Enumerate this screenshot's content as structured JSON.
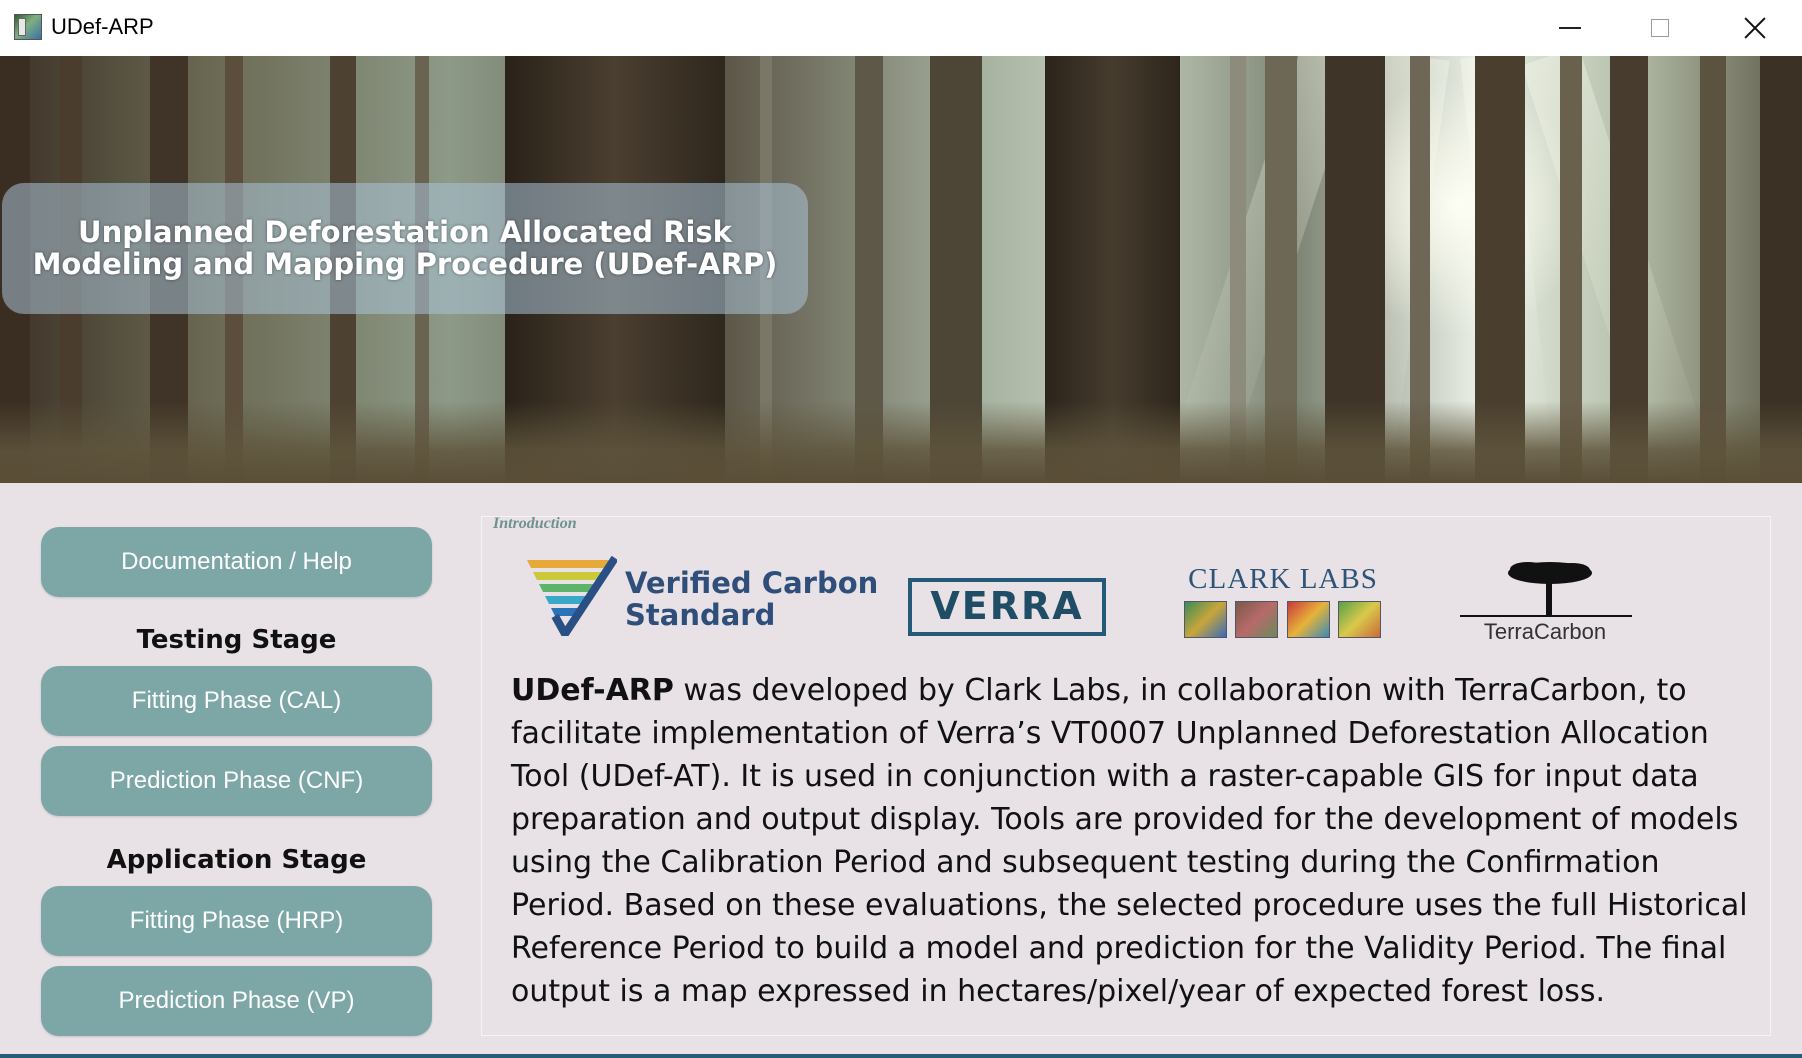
{
  "window": {
    "title": "UDef-ARP",
    "icons": {
      "app": "app-icon",
      "minimize": "minimize-icon",
      "maximize": "maximize-icon",
      "close": "close-icon"
    }
  },
  "banner": {
    "title_line1": "Unplanned Deforestation Allocated Risk",
    "title_line2": "Modeling and Mapping Procedure (UDef-ARP)"
  },
  "sidebar": {
    "documentation_button": "Documentation / Help",
    "testing_stage_label": "Testing Stage",
    "testing_fit_button": "Fitting Phase (CAL)",
    "testing_predict_button": "Prediction Phase (CNF)",
    "application_stage_label": "Application Stage",
    "application_fit_button": "Fitting Phase (HRP)",
    "application_predict_button": "Prediction Phase (VP)"
  },
  "introduction": {
    "label": "Introduction",
    "logos": {
      "vcs_line1": "Verified Carbon",
      "vcs_line2": "Standard",
      "verra": "VERRA",
      "clark_labs": "CLARK LABS",
      "terracarbon": "TerraCarbon"
    },
    "body_bold": "UDef-ARP",
    "body_rest": " was developed by Clark Labs, in collaboration with TerraCarbon, to facilitate implementation of Verra’s VT0007 Unplanned Deforestation Allocation Tool (UDef-AT). It is used in conjunction with a raster-capable GIS for input data preparation and output display. Tools are provided for the development of models using the Calibration Period and subsequent testing during the Confirmation Period. Based on these evaluations, the selected procedure uses the full Historical Reference Period to build a model and prediction for the Validity Period. The final output is a map expressed in hectares/pixel/year of expected forest loss."
  },
  "colors": {
    "button": "#7da6a6",
    "panel_bg": "#e8e2e6",
    "intro_label": "#6f9191"
  }
}
